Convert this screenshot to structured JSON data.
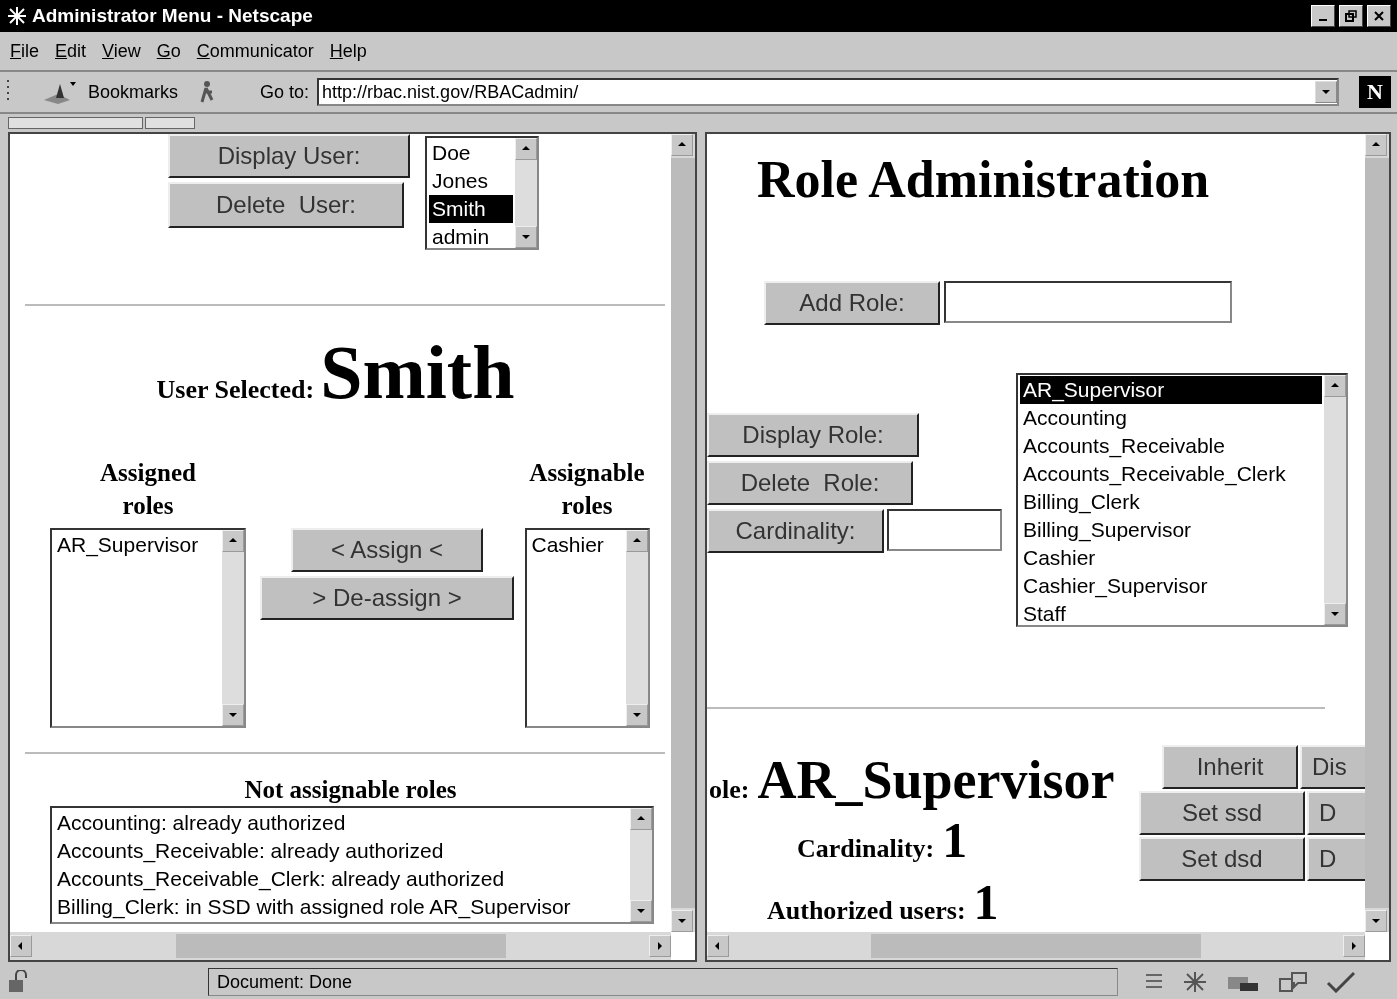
{
  "window": {
    "title": "Administrator Menu - Netscape"
  },
  "menu": [
    "File",
    "Edit",
    "View",
    "Go",
    "Communicator",
    "Help"
  ],
  "toolbar": {
    "bookmarks": "Bookmarks",
    "goto_label": "Go to:",
    "url": "http://rbac.nist.gov/RBACadmin/",
    "logo": "N"
  },
  "left_frame": {
    "user_buttons": [
      "Display User:",
      "Delete  User:"
    ],
    "users": [
      {
        "name": "Doe",
        "selected": false
      },
      {
        "name": "Jones",
        "selected": false
      },
      {
        "name": "Smith",
        "selected": true
      },
      {
        "name": "admin",
        "selected": false
      }
    ],
    "user_selected_label": "User Selected:",
    "user_selected": "Smith",
    "assigned_heading": "Assigned roles",
    "assigned_roles": [
      "AR_Supervisor"
    ],
    "assign_buttons": [
      "< Assign <",
      "> De-assign >"
    ],
    "assignable_heading": "Assignable roles",
    "assignable_roles": [
      "Cashier"
    ],
    "not_assignable_heading": "Not assignable roles",
    "not_assignable": [
      "Accounting: already authorized",
      "Accounts_Receivable: already authorized",
      "Accounts_Receivable_Clerk: already authorized",
      "Billing_Clerk: in SSD with assigned role AR_Supervisor"
    ]
  },
  "right_frame": {
    "title": "Role Administration",
    "add_role_button": "Add Role:",
    "role_buttons": [
      "Display Role:",
      "Delete  Role:"
    ],
    "cardinality_button": "Cardinality:",
    "roles": [
      {
        "name": "AR_Supervisor",
        "selected": true
      },
      {
        "name": "Accounting",
        "selected": false
      },
      {
        "name": "Accounts_Receivable",
        "selected": false
      },
      {
        "name": "Accounts_Receivable_Clerk",
        "selected": false
      },
      {
        "name": "Billing_Clerk",
        "selected": false
      },
      {
        "name": "Billing_Supervisor",
        "selected": false
      },
      {
        "name": "Cashier",
        "selected": false
      },
      {
        "name": "Cashier_Supervisor",
        "selected": false
      },
      {
        "name": "Staff",
        "selected": false
      }
    ],
    "role_label": "ole:",
    "role_value": "AR_Supervisor",
    "cardinality_label": "Cardinality:",
    "cardinality_value": "1",
    "authorized_label": "Authorized users:",
    "authorized_value": "1",
    "action_buttons": [
      [
        "Inherit",
        "Dis"
      ],
      [
        "Set ssd",
        "D"
      ],
      [
        "Set dsd",
        "D"
      ]
    ]
  },
  "status_bar": {
    "text": "Document: Done"
  }
}
